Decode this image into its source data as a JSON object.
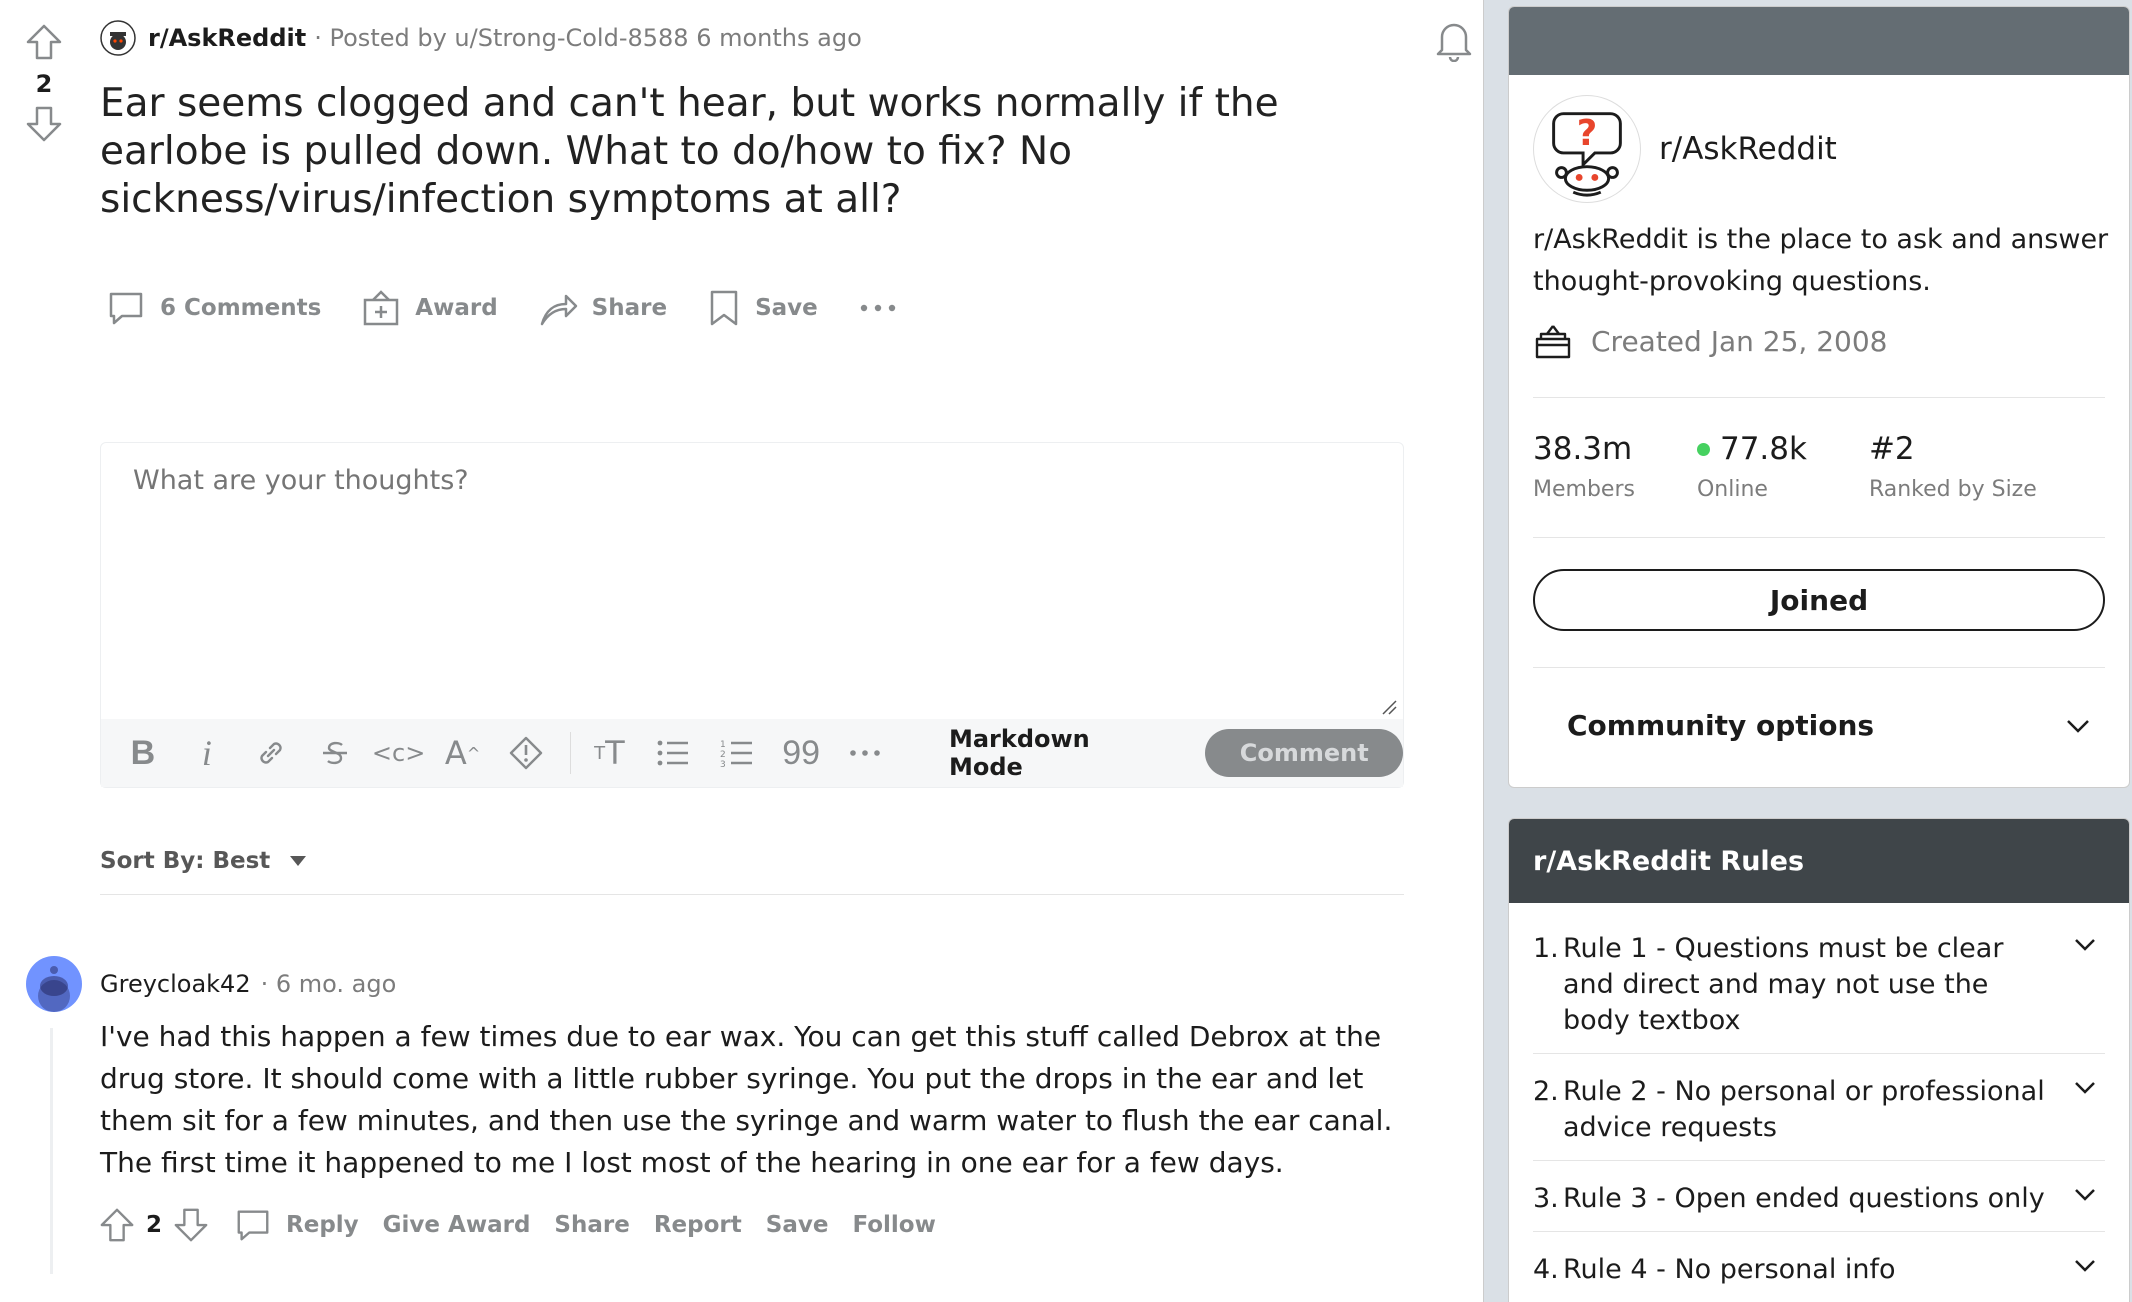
{
  "post": {
    "vote_count": "2",
    "subreddit": "r/AskReddit",
    "posted_by": "· Posted by u/Strong-Cold-8588 6 months ago",
    "title": "Ear seems clogged and can't hear, but works normally if the earlobe is pulled down. What to do/how to fix? No sickness/virus/infection symptoms at all?",
    "actions": {
      "comments": "6 Comments",
      "award": "Award",
      "share": "Share",
      "save": "Save"
    }
  },
  "comment_box": {
    "placeholder": "What are your thoughts?",
    "markdown_mode": "Markdown Mode",
    "comment_button": "Comment"
  },
  "sort": {
    "label": "Sort By: Best"
  },
  "comment": {
    "author": "Greycloak42",
    "time": "· 6 mo. ago",
    "body": "I've had this happen a few times due to ear wax. You can get this stuff called Debrox at the drug store. It should come with a little rubber syringe. You put the drops in the ear and let them sit for a few minutes, and then use the syringe and warm water to flush the ear canal. The first time it happened to me I lost most of the hearing in one ear for a few days.",
    "vote_count": "2",
    "actions": {
      "reply": "Reply",
      "give_award": "Give Award",
      "share": "Share",
      "report": "Report",
      "save": "Save",
      "follow": "Follow"
    }
  },
  "sidebar": {
    "about": {
      "name": "r/AskReddit",
      "description": "r/AskReddit is the place to ask and answer thought-provoking questions.",
      "created": "Created Jan 25, 2008",
      "stats": [
        {
          "value": "38.3m",
          "label": "Members"
        },
        {
          "value": "77.8k",
          "label": "Online"
        },
        {
          "value": "#2",
          "label": "Ranked by Size"
        }
      ],
      "joined_button": "Joined",
      "community_options": "Community options"
    },
    "rules": {
      "title": "r/AskReddit Rules",
      "items": [
        {
          "num": "1.",
          "text": "Rule 1 - Questions must be clear and direct and may not use the body textbox"
        },
        {
          "num": "2.",
          "text": "Rule 2 - No personal or professional advice requests"
        },
        {
          "num": "3.",
          "text": "Rule 3 - Open ended questions only"
        },
        {
          "num": "4.",
          "text": "Rule 4 - No personal info"
        }
      ]
    }
  },
  "colors": {
    "page_bg": "#dae0e6",
    "banner": "#646d73",
    "rules_header": "#3f4549",
    "online_dot": "#46d160",
    "comment_avatar": "#7193ff"
  }
}
